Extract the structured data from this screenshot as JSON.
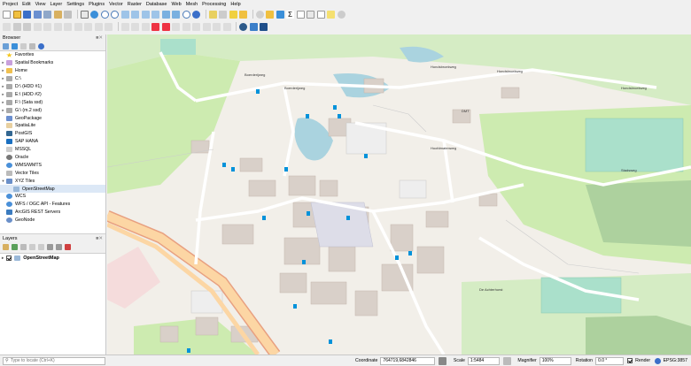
{
  "menu": [
    "Project",
    "Edit",
    "View",
    "Layer",
    "Settings",
    "Plugins",
    "Vector",
    "Raster",
    "Database",
    "Web",
    "Mesh",
    "Processing",
    "Help"
  ],
  "browser": {
    "title": "Browser",
    "items": [
      {
        "label": "Favorites",
        "icon": "star-icon"
      },
      {
        "label": "Spatial Bookmarks",
        "icon": "bookmark-icon"
      },
      {
        "label": "Home",
        "icon": "folder-icon"
      },
      {
        "label": "C:\\",
        "icon": "drive-icon"
      },
      {
        "label": "D:\\ (HDD #1)",
        "icon": "drive-icon"
      },
      {
        "label": "E:\\ (HDD #2)",
        "icon": "drive-icon"
      },
      {
        "label": "F:\\ (Sata ssd)",
        "icon": "drive-icon"
      },
      {
        "label": "G:\\ (m.2 ssd)",
        "icon": "drive-icon"
      },
      {
        "label": "GeoPackage",
        "icon": "geopackage-icon"
      },
      {
        "label": "SpatiaLite",
        "icon": "spatialite-icon"
      },
      {
        "label": "PostGIS",
        "icon": "postgis-icon"
      },
      {
        "label": "SAP HANA",
        "icon": "hana-icon"
      },
      {
        "label": "MSSQL",
        "icon": "mssql-icon"
      },
      {
        "label": "Oracle",
        "icon": "oracle-icon"
      },
      {
        "label": "WMS/WMTS",
        "icon": "wms-icon"
      },
      {
        "label": "Vector Tiles",
        "icon": "vector-tiles-icon"
      },
      {
        "label": "XYZ Tiles",
        "icon": "xyz-tiles-icon"
      },
      {
        "label": "OpenStreetMap",
        "icon": "xyz-layer-icon"
      },
      {
        "label": "WCS",
        "icon": "wcs-icon"
      },
      {
        "label": "WFS / OGC API - Features",
        "icon": "wfs-icon"
      },
      {
        "label": "ArcGIS REST Servers",
        "icon": "arcgis-icon"
      },
      {
        "label": "GeoNode",
        "icon": "geonode-icon"
      }
    ]
  },
  "layers": {
    "title": "Layers",
    "items": [
      {
        "label": "OpenStreetMap",
        "visible": true
      }
    ]
  },
  "map": {
    "labels": {
      "boerderijweg_1": "Boerderijweg",
      "boerderijweg_2": "Boerderijweg",
      "hondsbroekweg_1": "Hondsbroekweg",
      "hondsbroekweg_2": "Hondsbroekweg",
      "hondsbroekweg_3": "Hondsbroekweg",
      "hoofdmatenweg": "Hoofdmatenweg",
      "stadsweg": "Stadsweg",
      "de_achterhorst": "De Achterhorst",
      "dmt": "DMT"
    }
  },
  "status": {
    "locator_placeholder": "Type to locate (Ctrl+K)",
    "coordinate_label": "Coordinate",
    "coordinate": "764719,6842846",
    "scale_label": "Scale",
    "scale": "1:5484",
    "magnifier_label": "Magnifier",
    "magnifier": "100%",
    "rotation_label": "Rotation",
    "rotation": "0.0 °",
    "render_label": "Render",
    "crs": "EPSG:3857"
  }
}
